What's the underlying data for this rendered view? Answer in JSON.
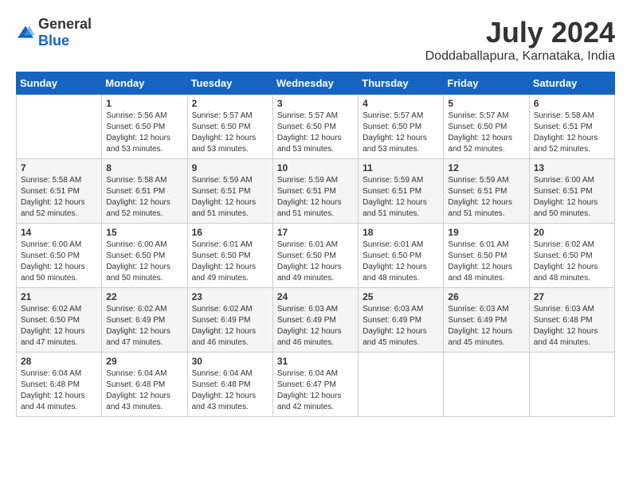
{
  "header": {
    "logo_general": "General",
    "logo_blue": "Blue",
    "month_title": "July 2024",
    "subtitle": "Doddaballapura, Karnataka, India"
  },
  "days_of_week": [
    "Sunday",
    "Monday",
    "Tuesday",
    "Wednesday",
    "Thursday",
    "Friday",
    "Saturday"
  ],
  "weeks": [
    [
      {
        "day": "",
        "info": ""
      },
      {
        "day": "1",
        "info": "Sunrise: 5:56 AM\nSunset: 6:50 PM\nDaylight: 12 hours\nand 53 minutes."
      },
      {
        "day": "2",
        "info": "Sunrise: 5:57 AM\nSunset: 6:50 PM\nDaylight: 12 hours\nand 53 minutes."
      },
      {
        "day": "3",
        "info": "Sunrise: 5:57 AM\nSunset: 6:50 PM\nDaylight: 12 hours\nand 53 minutes."
      },
      {
        "day": "4",
        "info": "Sunrise: 5:57 AM\nSunset: 6:50 PM\nDaylight: 12 hours\nand 53 minutes."
      },
      {
        "day": "5",
        "info": "Sunrise: 5:57 AM\nSunset: 6:50 PM\nDaylight: 12 hours\nand 52 minutes."
      },
      {
        "day": "6",
        "info": "Sunrise: 5:58 AM\nSunset: 6:51 PM\nDaylight: 12 hours\nand 52 minutes."
      }
    ],
    [
      {
        "day": "7",
        "info": "Sunrise: 5:58 AM\nSunset: 6:51 PM\nDaylight: 12 hours\nand 52 minutes."
      },
      {
        "day": "8",
        "info": "Sunrise: 5:58 AM\nSunset: 6:51 PM\nDaylight: 12 hours\nand 52 minutes."
      },
      {
        "day": "9",
        "info": "Sunrise: 5:59 AM\nSunset: 6:51 PM\nDaylight: 12 hours\nand 51 minutes."
      },
      {
        "day": "10",
        "info": "Sunrise: 5:59 AM\nSunset: 6:51 PM\nDaylight: 12 hours\nand 51 minutes."
      },
      {
        "day": "11",
        "info": "Sunrise: 5:59 AM\nSunset: 6:51 PM\nDaylight: 12 hours\nand 51 minutes."
      },
      {
        "day": "12",
        "info": "Sunrise: 5:59 AM\nSunset: 6:51 PM\nDaylight: 12 hours\nand 51 minutes."
      },
      {
        "day": "13",
        "info": "Sunrise: 6:00 AM\nSunset: 6:51 PM\nDaylight: 12 hours\nand 50 minutes."
      }
    ],
    [
      {
        "day": "14",
        "info": "Sunrise: 6:00 AM\nSunset: 6:50 PM\nDaylight: 12 hours\nand 50 minutes."
      },
      {
        "day": "15",
        "info": "Sunrise: 6:00 AM\nSunset: 6:50 PM\nDaylight: 12 hours\nand 50 minutes."
      },
      {
        "day": "16",
        "info": "Sunrise: 6:01 AM\nSunset: 6:50 PM\nDaylight: 12 hours\nand 49 minutes."
      },
      {
        "day": "17",
        "info": "Sunrise: 6:01 AM\nSunset: 6:50 PM\nDaylight: 12 hours\nand 49 minutes."
      },
      {
        "day": "18",
        "info": "Sunrise: 6:01 AM\nSunset: 6:50 PM\nDaylight: 12 hours\nand 48 minutes."
      },
      {
        "day": "19",
        "info": "Sunrise: 6:01 AM\nSunset: 6:50 PM\nDaylight: 12 hours\nand 48 minutes."
      },
      {
        "day": "20",
        "info": "Sunrise: 6:02 AM\nSunset: 6:50 PM\nDaylight: 12 hours\nand 48 minutes."
      }
    ],
    [
      {
        "day": "21",
        "info": "Sunrise: 6:02 AM\nSunset: 6:50 PM\nDaylight: 12 hours\nand 47 minutes."
      },
      {
        "day": "22",
        "info": "Sunrise: 6:02 AM\nSunset: 6:49 PM\nDaylight: 12 hours\nand 47 minutes."
      },
      {
        "day": "23",
        "info": "Sunrise: 6:02 AM\nSunset: 6:49 PM\nDaylight: 12 hours\nand 46 minutes."
      },
      {
        "day": "24",
        "info": "Sunrise: 6:03 AM\nSunset: 6:49 PM\nDaylight: 12 hours\nand 46 minutes."
      },
      {
        "day": "25",
        "info": "Sunrise: 6:03 AM\nSunset: 6:49 PM\nDaylight: 12 hours\nand 45 minutes."
      },
      {
        "day": "26",
        "info": "Sunrise: 6:03 AM\nSunset: 6:49 PM\nDaylight: 12 hours\nand 45 minutes."
      },
      {
        "day": "27",
        "info": "Sunrise: 6:03 AM\nSunset: 6:48 PM\nDaylight: 12 hours\nand 44 minutes."
      }
    ],
    [
      {
        "day": "28",
        "info": "Sunrise: 6:04 AM\nSunset: 6:48 PM\nDaylight: 12 hours\nand 44 minutes."
      },
      {
        "day": "29",
        "info": "Sunrise: 6:04 AM\nSunset: 6:48 PM\nDaylight: 12 hours\nand 43 minutes."
      },
      {
        "day": "30",
        "info": "Sunrise: 6:04 AM\nSunset: 6:48 PM\nDaylight: 12 hours\nand 43 minutes."
      },
      {
        "day": "31",
        "info": "Sunrise: 6:04 AM\nSunset: 6:47 PM\nDaylight: 12 hours\nand 42 minutes."
      },
      {
        "day": "",
        "info": ""
      },
      {
        "day": "",
        "info": ""
      },
      {
        "day": "",
        "info": ""
      }
    ]
  ]
}
